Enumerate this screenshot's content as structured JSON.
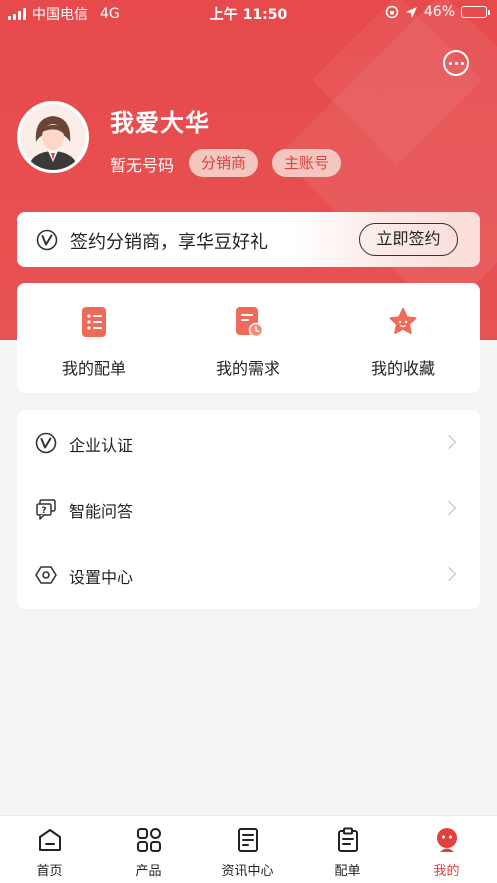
{
  "status_bar": {
    "carrier": "中国电信",
    "network": "4G",
    "time": "上午 11:50",
    "battery": "46%"
  },
  "profile": {
    "name": "我爱大华",
    "phone": "暂无号码",
    "tags": [
      "分销商",
      "主账号"
    ]
  },
  "banner": {
    "text": "签约分销商，享华豆好礼",
    "button": "立即签约"
  },
  "quick_actions": [
    {
      "label": "我的配单",
      "icon": "list-icon"
    },
    {
      "label": "我的需求",
      "icon": "document-clock-icon"
    },
    {
      "label": "我的收藏",
      "icon": "star-icon"
    }
  ],
  "menu": [
    {
      "label": "企业认证",
      "icon": "verified-v-icon"
    },
    {
      "label": "智能问答",
      "icon": "chat-question-icon"
    },
    {
      "label": "设置中心",
      "icon": "settings-hexagon-icon"
    }
  ],
  "tabbar": [
    {
      "label": "首页",
      "icon": "home-icon"
    },
    {
      "label": "产品",
      "icon": "grid-icon"
    },
    {
      "label": "资讯中心",
      "icon": "news-icon"
    },
    {
      "label": "配单",
      "icon": "clipboard-icon"
    },
    {
      "label": "我的",
      "icon": "user-icon",
      "active": true
    }
  ],
  "colors": {
    "brand_red": "#e64a4c",
    "tag_bg": "#f3c6bf",
    "active_tab": "#e2403f"
  }
}
